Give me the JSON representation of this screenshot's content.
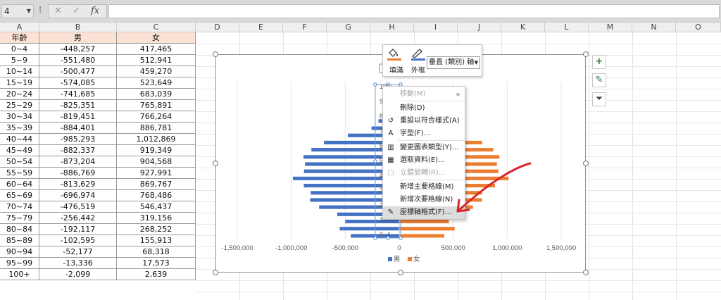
{
  "name_box": {
    "value": "4"
  },
  "formula_bar": {
    "dots": "⁝",
    "cancel": "✕",
    "enter": "✓",
    "fx": "fx",
    "value": ""
  },
  "columns": [
    "A",
    "B",
    "C",
    "D",
    "E",
    "F",
    "G",
    "H",
    "I",
    "J",
    "K",
    "L",
    "M",
    "N",
    "O"
  ],
  "table": {
    "headers": [
      "年齡",
      "男",
      "女"
    ],
    "rows": [
      [
        "0~4",
        "-448,257",
        "417,465"
      ],
      [
        "5~9",
        "-551,480",
        "512,941"
      ],
      [
        "10~14",
        "-500,477",
        "459,270"
      ],
      [
        "15~19",
        "-574,085",
        "523,649"
      ],
      [
        "20~24",
        "-741,685",
        "683,039"
      ],
      [
        "25~29",
        "-825,351",
        "765,891"
      ],
      [
        "30~34",
        "-819,451",
        "766,264"
      ],
      [
        "35~39",
        "-884,401",
        "886,781"
      ],
      [
        "40~44",
        "-985,293",
        "1,012,869"
      ],
      [
        "45~49",
        "-882,337",
        "919,349"
      ],
      [
        "50~54",
        "-873,204",
        "904,568"
      ],
      [
        "55~59",
        "-886,769",
        "927,991"
      ],
      [
        "60~64",
        "-813,629",
        "869,767"
      ],
      [
        "65~69",
        "-696,974",
        "768,486"
      ],
      [
        "70~74",
        "-476,519",
        "546,437"
      ],
      [
        "75~79",
        "-256,442",
        "319,156"
      ],
      [
        "80~84",
        "-192,117",
        "268,252"
      ],
      [
        "85~89",
        "-102,595",
        "155,913"
      ],
      [
        "90~94",
        "-52,177",
        "68,318"
      ],
      [
        "95~99",
        "-13,336",
        "17,573"
      ],
      [
        "100+",
        "-2,099",
        "2,639"
      ]
    ]
  },
  "chart_data": {
    "type": "bar",
    "orientation": "horizontal",
    "categories": [
      "0~4",
      "5~9",
      "10~14",
      "15~19",
      "20~24",
      "25~29",
      "30~34",
      "35~39",
      "40~44",
      "45~49",
      "50~54",
      "55~59",
      "60~64",
      "65~69",
      "70~74",
      "75~79",
      "80~84",
      "85~89",
      "90~94",
      "95~99",
      "100+"
    ],
    "series": [
      {
        "name": "男",
        "color": "#4472c4",
        "values": [
          -448257,
          -551480,
          -500477,
          -574085,
          -741685,
          -825351,
          -819451,
          -884401,
          -985293,
          -882337,
          -873204,
          -886769,
          -813629,
          -696974,
          -476519,
          -256442,
          -192117,
          -102595,
          -52177,
          -13336,
          -2099
        ]
      },
      {
        "name": "女",
        "color": "#ed7d31",
        "values": [
          417465,
          512941,
          459270,
          523649,
          683039,
          765891,
          766264,
          886781,
          1012869,
          919349,
          904568,
          927991,
          869767,
          768486,
          546437,
          319156,
          268252,
          155913,
          68318,
          17573,
          2639
        ]
      }
    ],
    "xlim": [
      -1500000,
      1500000
    ],
    "xticks": [
      "-1,500,000",
      "-1,000,000",
      "-500,000",
      "0",
      "500,000",
      "1,000,000",
      "1,500,000"
    ],
    "yticks_visible": [
      "100+",
      "90",
      "80",
      "70",
      "60",
      "50",
      "40",
      "30",
      "20",
      "10",
      "0~4"
    ],
    "legend": {
      "position": "bottom",
      "entries": [
        "男",
        "女"
      ]
    },
    "grid": true
  },
  "mini_toolbar": {
    "fill_label": "填滿",
    "outline_label": "外框",
    "element_select": "垂直 (類別) 軸",
    "fill_color": "#ed7d31",
    "outline_color": "#4472c4"
  },
  "context_menu": {
    "items": [
      {
        "label": "移動(M)",
        "icon": "",
        "disabled": true,
        "submenu": true
      },
      {
        "label": "刪除(D)",
        "icon": "",
        "disabled": false
      },
      {
        "label": "重設以符合樣式(A)",
        "icon": "reset-style-icon",
        "disabled": false
      },
      {
        "label": "字型(F)...",
        "icon": "font-icon",
        "disabled": false
      },
      {
        "label": "變更圖表類型(Y)...",
        "icon": "chart-type-icon",
        "disabled": false
      },
      {
        "label": "選取資料(E)...",
        "icon": "select-data-icon",
        "disabled": false
      },
      {
        "label": "立體旋轉(R)...",
        "icon": "3d-rotate-icon",
        "disabled": true
      },
      {
        "label": "新增主要格線(M)",
        "icon": "",
        "disabled": false
      },
      {
        "label": "新增次要格線(N)",
        "icon": "",
        "disabled": false
      },
      {
        "label": "座標軸格式(F)...",
        "icon": "format-axis-icon",
        "disabled": false,
        "highlighted": true
      }
    ]
  },
  "side_buttons": {
    "elements": "+",
    "styles": "✎",
    "filter": "⏷"
  },
  "annotation_color": "#d9262c"
}
